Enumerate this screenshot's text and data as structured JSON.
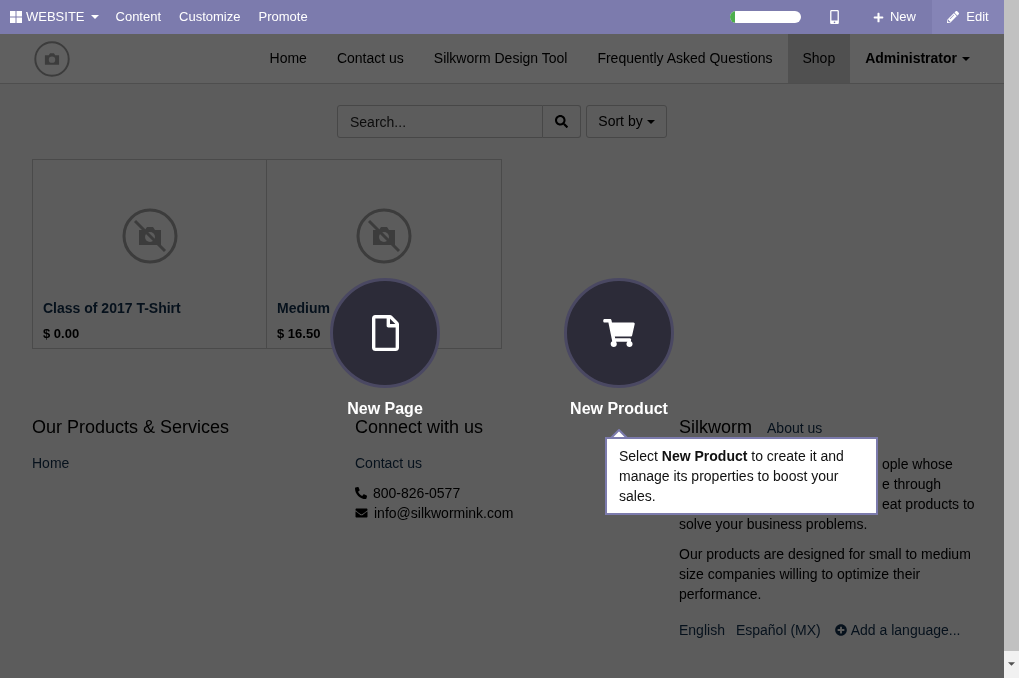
{
  "top_bar": {
    "app_menu": {
      "label": "WEBSITE"
    },
    "menus": [
      "Content",
      "Customize",
      "Promote"
    ],
    "progress": {
      "level": 0.07
    },
    "new_button": {
      "label": "New"
    },
    "edit_button": {
      "label": "Edit"
    }
  },
  "navbar": {
    "items": [
      {
        "label": "Home",
        "selected": false
      },
      {
        "label": "Contact us",
        "selected": false
      },
      {
        "label": "Silkworm Design Tool",
        "selected": false
      },
      {
        "label": "Frequently Asked Questions",
        "selected": false
      },
      {
        "label": "Shop",
        "selected": true
      }
    ],
    "user_menu": {
      "label": "Administrator"
    }
  },
  "shop": {
    "search": {
      "placeholder": "Search..."
    },
    "sort_button": {
      "label": "Sort by"
    },
    "products": [
      {
        "name": "Class of 2017 T-Shirt",
        "price": "$ 0.00"
      },
      {
        "name": "Medium",
        "price": "$ 16.50"
      }
    ]
  },
  "new_content": {
    "options": [
      {
        "kind": "page",
        "label": "New Page"
      },
      {
        "kind": "product",
        "label": "New Product"
      }
    ],
    "tooltip": {
      "text": "Select **New Product** to create it and manage its properties to boost your sales."
    }
  },
  "footer": {
    "products_column": {
      "heading": "Our Products & Services",
      "links": [
        "Home"
      ]
    },
    "connect_column": {
      "heading": "Connect with us",
      "links": [
        "Contact us"
      ],
      "contacts": [
        {
          "kind": "phone",
          "text": "800-826-0577"
        },
        {
          "kind": "email",
          "text": "info@silkwormink.com"
        }
      ]
    },
    "about_column": {
      "heading": "Silkworm",
      "subheading": "About us",
      "cut_lines": [
        "ople whose",
        "e through",
        "eat products to"
      ],
      "paragraphs": [
        "solve your business problems.",
        "Our products are designed for small to medium size companies willing to optimize their performance."
      ],
      "languages": [
        "English",
        "Español (MX)"
      ],
      "add_language": {
        "label": "Add a language..."
      }
    }
  }
}
